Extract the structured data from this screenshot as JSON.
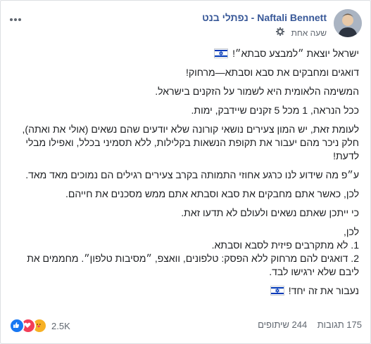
{
  "post": {
    "author": "Naftali Bennett - נפתלי בנט",
    "time": "שעה אחת",
    "body": [
      "ישראל יוצאת ״למבצע סבתא״!",
      "דואגים ומחבקים את סבא וסבתא—מרחוק!",
      "המשימה הלאומית היא לשמור על הזקנים בישראל.",
      "ככל הנראה, 1 מכל 5 זקנים שיידבק, ימות.",
      "לעומת זאת, יש המון צעירים נושאי קורונה שלא יודעים שהם נשאים (אולי את ואתה), חלק ניכר מהם יעבור את תקופת הנשאות בקלילות, ללא תסמיני בכלל, ואפילו מבלי לדעת!",
      "ע״פ מה שידוע לנו כרגע אחוזי התמותה בקרב צעירים רגילים הם נמוכים מאד מאד.",
      "לכן, כאשר אתם מחבקים את סבא וסבתא אתם ממש מסכנים את חייהם.",
      "כי ייתכן שאתם נשאים ולעולם לא תדעו זאת.",
      "לכן,",
      "1. לא מתקרבים פיזית לסבא וסבתא.",
      "2. דואגים להם מרחוק ללא הפסק: טלפונים, וואצפ, ״מסיבות טלפון״. מחממים את ליבם שלא ירגישו לבד.",
      "נעבור את זה יחד!"
    ]
  },
  "footer": {
    "reactions_count": "2.5K",
    "comments": "175 תגובות",
    "shares": "244 שיתופים"
  },
  "icons": {
    "menu": "more-dots-icon",
    "audience": "gear-icon",
    "flag": "israel-flag-icon",
    "like": "like-icon",
    "love": "love-icon",
    "care": "care-icon"
  },
  "colors": {
    "author": "#385898",
    "like": "#1877f2",
    "love": "#f33e58",
    "care": "#f7b125",
    "flag_blue": "#0038b8"
  }
}
